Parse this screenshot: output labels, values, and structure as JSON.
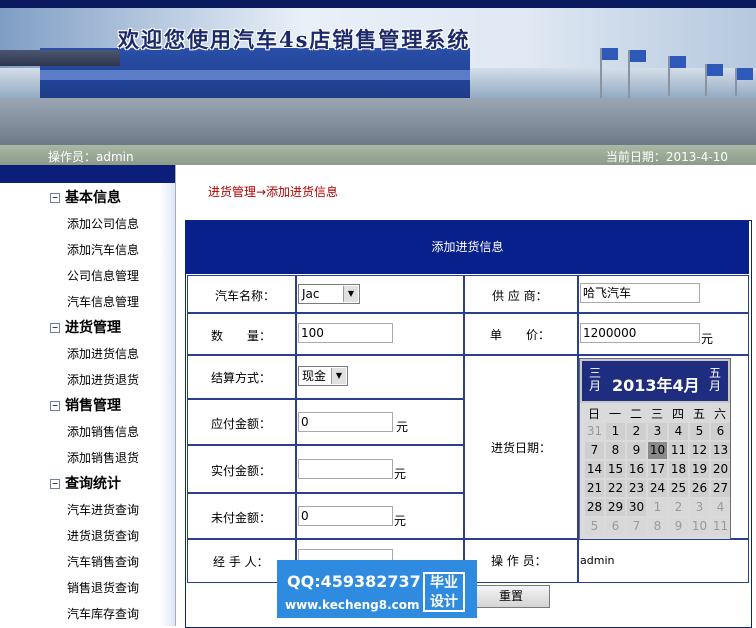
{
  "header": {
    "title": "欢迎您使用汽车4s店销售管理系统",
    "operator": "操作员：admin",
    "current_date": "当前日期：2013-4-10"
  },
  "sidebar": {
    "groups": [
      {
        "title": "基本信息",
        "items": [
          "添加公司信息",
          "添加汽车信息",
          "公司信息管理",
          "汽车信息管理"
        ]
      },
      {
        "title": "进货管理",
        "items": [
          "添加进货信息",
          "添加进货退货"
        ]
      },
      {
        "title": "销售管理",
        "items": [
          "添加销售信息",
          "添加销售退货"
        ]
      },
      {
        "title": "查询统计",
        "items": [
          "汽车进货查询",
          "进货退货查询",
          "汽车销售查询",
          "销售退货查询",
          "汽车库存查询"
        ]
      }
    ]
  },
  "breadcrumb": "进货管理→添加进货信息",
  "form": {
    "title": "添加进货信息",
    "car_name_label": "汽车名称：",
    "car_name_value": "Jac",
    "supplier_label": "供 应 商：",
    "supplier_value": "哈飞汽车",
    "quantity_label": "数　　量：",
    "quantity_value": "100",
    "unit_price_label": "单　　价：",
    "unit_price_value": "1200000",
    "unit_yuan": "元",
    "payment_method_label": "结算方式：",
    "payment_method_value": "现金",
    "payable_label": "应付金额：",
    "payable_value": "0",
    "paid_label": "实付金额：",
    "paid_value": "",
    "unpaid_label": "未付金额：",
    "unpaid_value": "0",
    "purchase_date_label": "进货日期：",
    "handler_label": "经 手 人：",
    "handler_value": "",
    "operator_label": "操 作 员：",
    "operator_value": "admin",
    "reset_label": "重置"
  },
  "calendar": {
    "title": "2013年4月",
    "prev_label": "三月",
    "next_label": "五月",
    "weekdays": [
      "日",
      "一",
      "二",
      "三",
      "四",
      "五",
      "六"
    ],
    "weeks": [
      [
        "31",
        "1",
        "2",
        "3",
        "4",
        "5",
        "6"
      ],
      [
        "7",
        "8",
        "9",
        "10",
        "11",
        "12",
        "13"
      ],
      [
        "14",
        "15",
        "16",
        "17",
        "18",
        "19",
        "20"
      ],
      [
        "21",
        "22",
        "23",
        "24",
        "25",
        "26",
        "27"
      ],
      [
        "28",
        "29",
        "30",
        "1",
        "2",
        "3",
        "4"
      ],
      [
        "5",
        "6",
        "7",
        "8",
        "9",
        "10",
        "11"
      ]
    ],
    "selected_day": "10"
  },
  "watermark": {
    "qq": "QQ:459382737",
    "url": "www.kecheng8.com",
    "badge": "毕业设计"
  }
}
